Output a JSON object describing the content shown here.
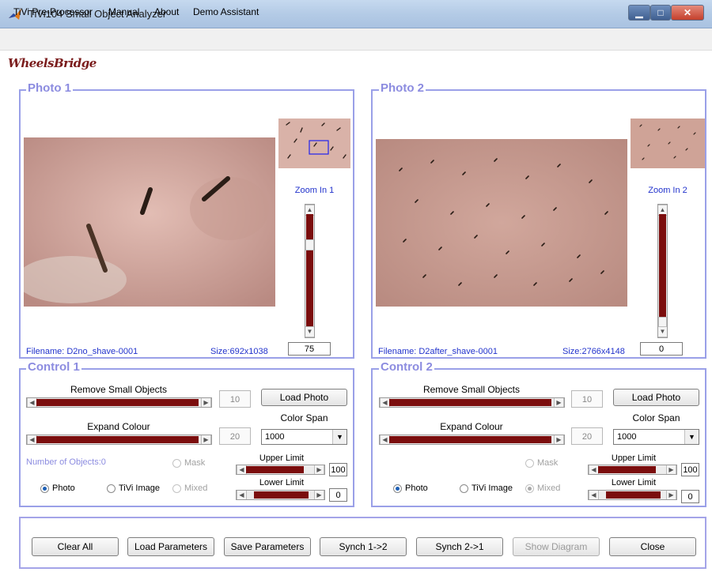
{
  "window": {
    "title": "TiVi104 Small Object Analyzer"
  },
  "menu": [
    "TiVi Pre-Processor",
    "Manual",
    "About",
    "Demo Assistant"
  ],
  "logo_text": "WheelsBridge",
  "photo1": {
    "title": "Photo 1",
    "zoom_label": "Zoom In 1",
    "filename": "Filename: D2no_shave-0001",
    "size": "Size:692x1038",
    "zoom_value": "75"
  },
  "photo2": {
    "title": "Photo 2",
    "zoom_label": "Zoom In 2",
    "filename": "Filename: D2after_shave-0001",
    "size": "Size:2766x4148",
    "zoom_value": "0"
  },
  "control1": {
    "title": "Control 1",
    "remove_label": "Remove Small Objects",
    "remove_value": "10",
    "load_photo": "Load Photo",
    "color_span_label": "Color Span",
    "color_span_value": "1000",
    "expand_label": "Expand Colour",
    "expand_value": "20",
    "objects_label": "Number of Objects:0",
    "mask_label": "Mask",
    "upper_label": "Upper Limit",
    "upper_value": "100",
    "lower_label": "Lower Limit",
    "lower_value": "0",
    "radio_photo": "Photo",
    "radio_tivi": "TiVi Image",
    "radio_mixed": "Mixed"
  },
  "control2": {
    "title": "Control 2",
    "remove_label": "Remove Small Objects",
    "remove_value": "10",
    "load_photo": "Load Photo",
    "color_span_label": "Color Span",
    "color_span_value": "1000",
    "expand_label": "Expand Colour",
    "expand_value": "20",
    "mask_label": "Mask",
    "upper_label": "Upper Limit",
    "upper_value": "100",
    "lower_label": "Lower Limit",
    "lower_value": "0",
    "radio_photo": "Photo",
    "radio_tivi": "TiVi Image",
    "radio_mixed": "Mixed"
  },
  "footer": {
    "clear_all": "Clear All",
    "load_parameters": "Load Parameters",
    "save_parameters": "Save Parameters",
    "synch_1_2": "Synch 1->2",
    "synch_2_1": "Synch 2->1",
    "show_diagram": "Show Diagram",
    "close": "Close"
  },
  "colors": {
    "accent": "#9aa0e8",
    "slider": "#7b0d0d",
    "link": "#2233cc"
  }
}
